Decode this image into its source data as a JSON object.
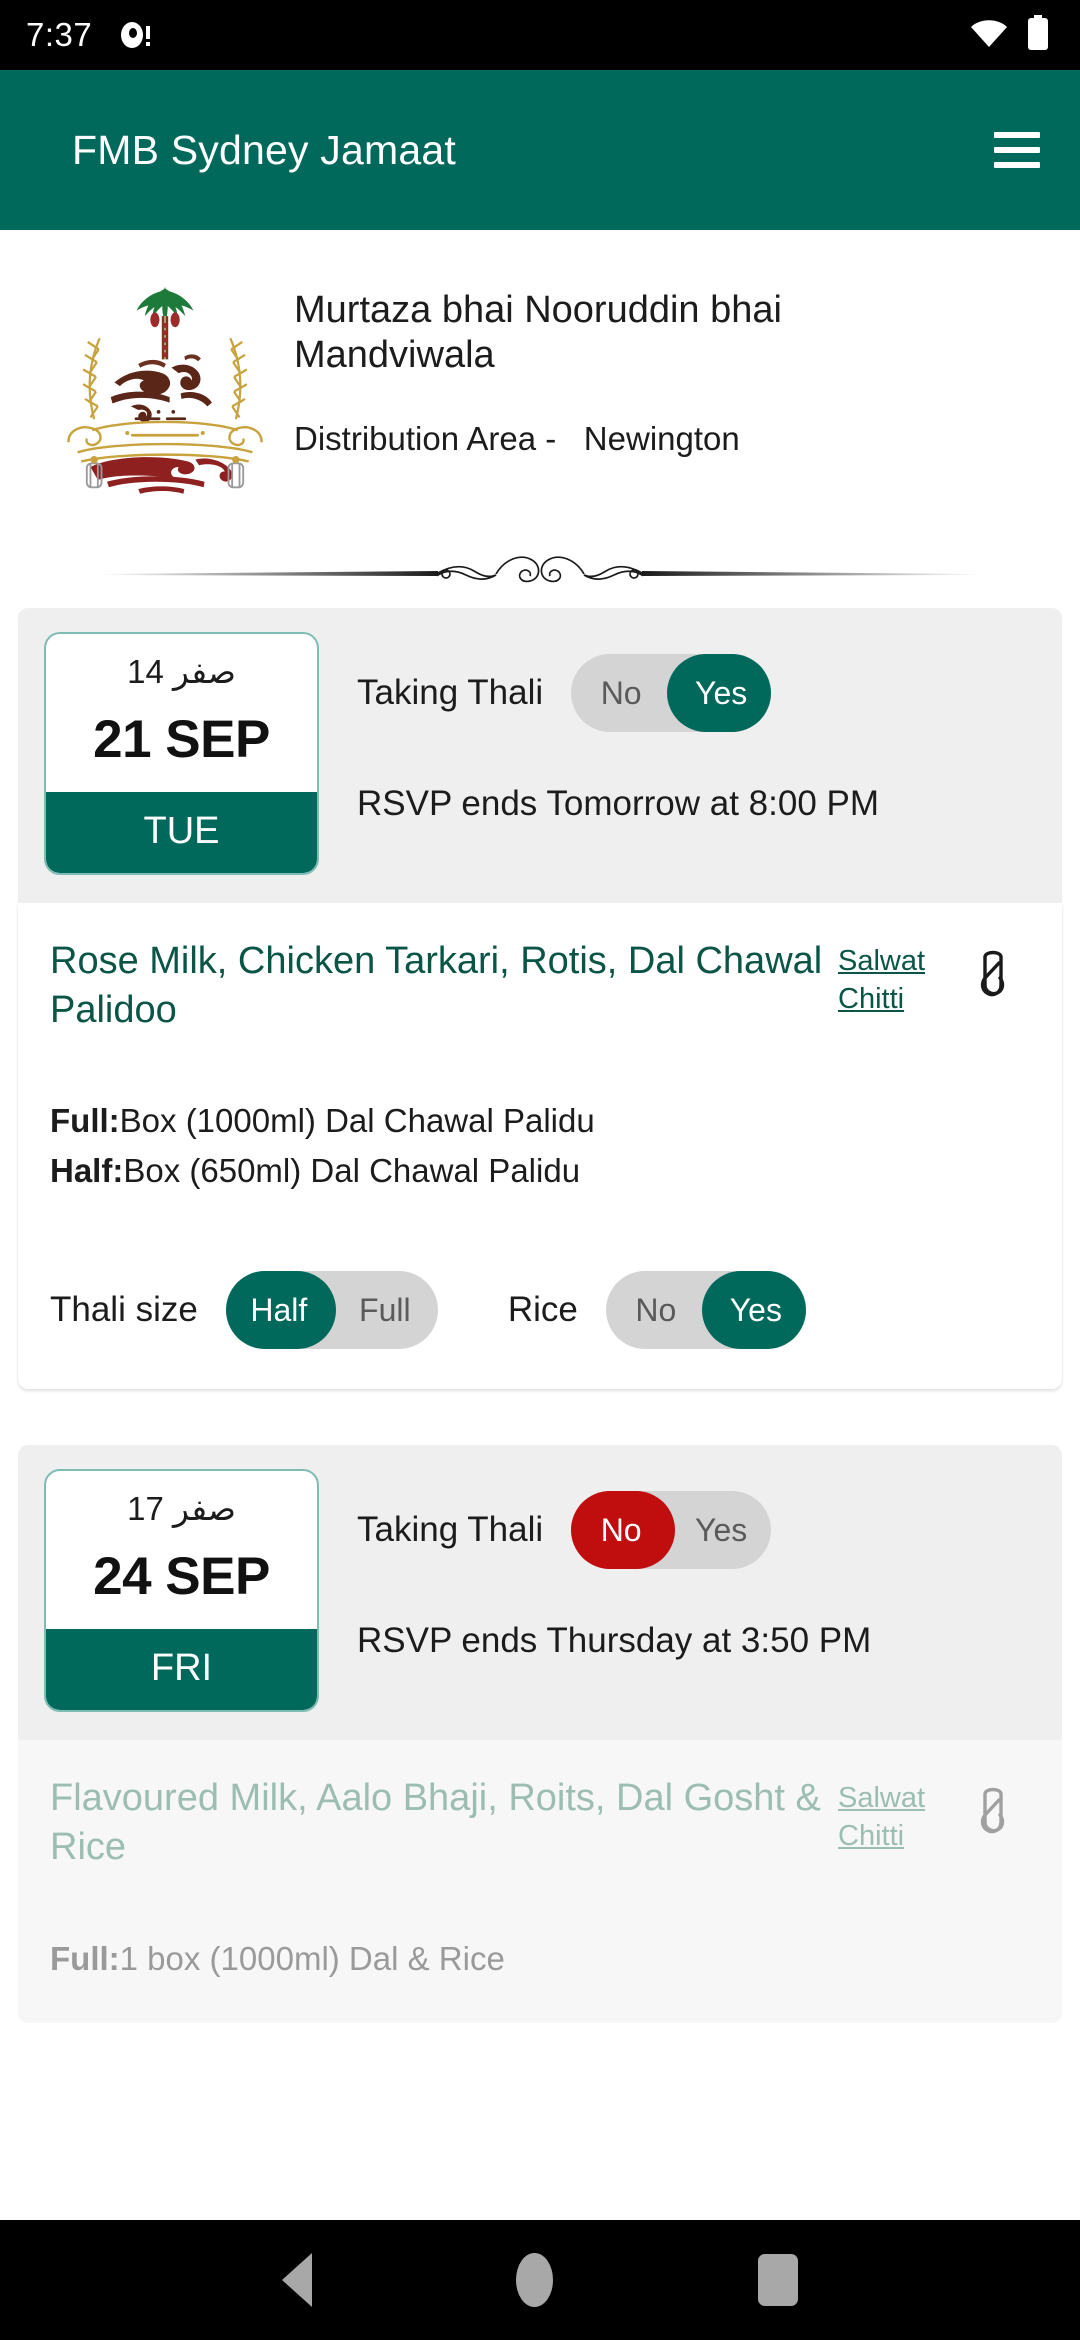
{
  "status_bar": {
    "time": "7:37",
    "notification_icon": "camera-notification-icon",
    "wifi_icon": "wifi-icon",
    "battery_icon": "battery-icon"
  },
  "app_bar": {
    "title": "FMB Sydney Jamaat",
    "menu_icon": "hamburger-menu-icon",
    "background_color": "#00695C"
  },
  "profile": {
    "logo_alt": "fmb-burhani-logo",
    "name": "Murtaza bhai Nooruddin bhai Mandviwala",
    "area_label": "Distribution Area -",
    "area_value": "Newington",
    "divider_icon": "ornamental-flourish-divider"
  },
  "colors": {
    "brand_green": "#00695C",
    "link_green": "#0b5546",
    "danger_red": "#C00D0D",
    "toggle_track": "#d4d4d4",
    "card_header_bg": "#efefef"
  },
  "days": [
    {
      "hijri": "صفر 14",
      "gregorian": "21 SEP",
      "day_of_week": "TUE",
      "rsvp_label": "Taking Thali",
      "toggle": {
        "option_a": "No",
        "option_b": "Yes",
        "selected": "Yes"
      },
      "rsvp_ends": "RSVP ends Tomorrow at 8:00 PM",
      "menu": {
        "title": "Rose Milk, Chicken Tarkari, Rotis, Dal Chawal Palidoo",
        "chitti_link": "Salwat Chitti",
        "attachment_icon": "paperclip-icon",
        "portions": [
          {
            "label": "Full:",
            "value": "Box (1000ml) Dal Chawal Palidu"
          },
          {
            "label": "Half:",
            "value": "Box (650ml) Dal Chawal Palidu"
          }
        ],
        "options": [
          {
            "label": "Thali size",
            "toggle": {
              "option_a": "Half",
              "option_b": "Full",
              "selected": "Half"
            }
          },
          {
            "label": "Rice",
            "toggle": {
              "option_a": "No",
              "option_b": "Yes",
              "selected": "Yes"
            }
          }
        ],
        "disabled": false
      }
    },
    {
      "hijri": "صفر 17",
      "gregorian": "24 SEP",
      "day_of_week": "FRI",
      "rsvp_label": "Taking Thali",
      "toggle": {
        "option_a": "No",
        "option_b": "Yes",
        "selected": "No"
      },
      "rsvp_ends": "RSVP ends Thursday at 3:50 PM",
      "menu": {
        "title": "Flavoured Milk, Aalo Bhaji, Roits, Dal Gosht & Rice",
        "chitti_link": "Salwat Chitti",
        "attachment_icon": "paperclip-icon",
        "portions": [
          {
            "label": "Full:",
            "value": "1 box (1000ml) Dal & Rice"
          }
        ],
        "options": [],
        "disabled": true
      }
    }
  ],
  "nav_bar": {
    "back_label": "back-button",
    "home_label": "home-button",
    "recents_label": "recents-button"
  }
}
